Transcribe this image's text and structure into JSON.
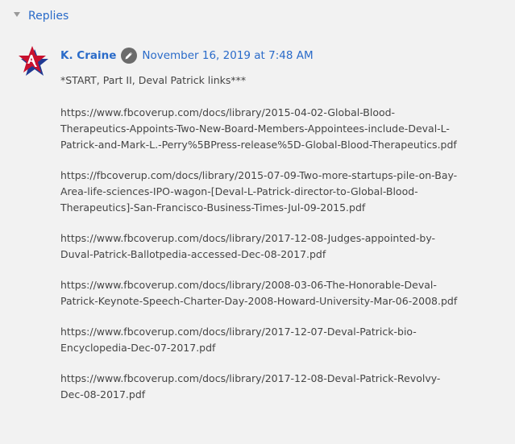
{
  "replies": {
    "label": "Replies"
  },
  "comment": {
    "author": "K. Craine",
    "timestamp": "November 16, 2019 at 7:48 AM",
    "lines": [
      {
        "rows": [
          "*START, Part II, Deval Patrick links***"
        ]
      },
      {
        "rows": [
          "https://www.fbcoverup.com/docs/library/2015-04-02-Global-Blood-",
          "Therapeutics-Appoints-Two-New-Board-Members-Appointees-include-Deval-L-",
          "Patrick-and-Mark-L.-Perry%5BPress-release%5D-Global-Blood-Therapeutics.pdf"
        ]
      },
      {
        "rows": [
          "https://fbcoverup.com/docs/library/2015-07-09-Two-more-startups-pile-on-Bay-",
          "Area-life-sciences-IPO-wagon-[Deval-L-Patrick-director-to-Global-Blood-",
          "Therapeutics]-San-Francisco-Business-Times-Jul-09-2015.pdf"
        ]
      },
      {
        "rows": [
          "https://www.fbcoverup.com/docs/library/2017-12-08-Judges-appointed-by-",
          "Duval-Patrick-Ballotpedia-accessed-Dec-08-2017.pdf"
        ]
      },
      {
        "rows": [
          "https://www.fbcoverup.com/docs/library/2008-03-06-The-Honorable-Deval-",
          "Patrick-Keynote-Speech-Charter-Day-2008-Howard-University-Mar-06-2008.pdf"
        ]
      },
      {
        "rows": [
          "https://www.fbcoverup.com/docs/library/2017-12-07-Deval-Patrick-bio-",
          "Encyclopedia-Dec-07-2017.pdf"
        ]
      },
      {
        "rows": [
          "https://www.fbcoverup.com/docs/library/2017-12-08-Deval-Patrick-Revolvy-",
          "Dec-08-2017.pdf"
        ]
      }
    ]
  },
  "icons": {
    "replies_toggle": "triangle-down-icon",
    "avatar": "star-logo-avatar",
    "blogger_badge": "pencil-icon"
  },
  "colors": {
    "link": "#2a6bc9",
    "text": "#444444",
    "background": "#f2f2f2",
    "avatar_star": "#c8102e",
    "avatar_shadow": "#1f3a93"
  }
}
